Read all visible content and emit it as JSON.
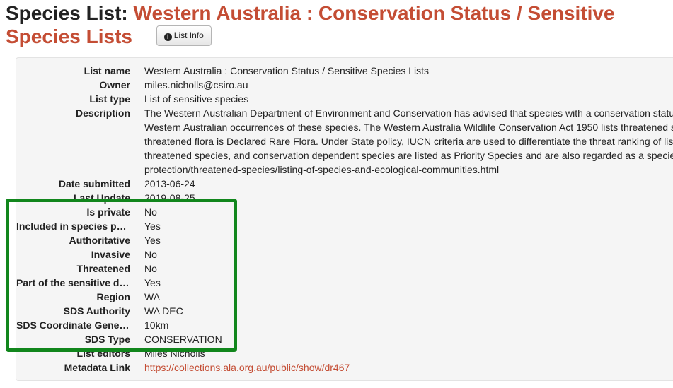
{
  "header": {
    "prefix": "Species List:",
    "list_name_line1": "Western Australia : Conservation Status / Sensitive",
    "list_name_line2": "Species Lists",
    "info_button": "List Info",
    "info_icon": "info-circle-icon"
  },
  "details": [
    {
      "label": "List name",
      "value": "Western Australia : Conservation Status / Sensitive Species Lists"
    },
    {
      "label": "Owner",
      "value": "miles.nicholls@csiro.au"
    },
    {
      "label": "List type",
      "value": "List of sensitive species"
    },
    {
      "label": "Description",
      "lines": [
        "The Western Australian Department of Environment and Conservation has advised that species with a conservation status",
        "Western Australian occurrences of these species. The Western Australia Wildlife Conservation Act 1950 lists threatened s",
        "threatened flora is Declared Rare Flora. Under State policy, IUCN criteria are used to differentiate the threat ranking of liste",
        "threatened species, and conservation dependent species are listed as Priority Species and are also regarded as a species",
        "protection/threatened-species/listing-of-species-and-ecological-communities.html"
      ]
    },
    {
      "label": "Date submitted",
      "value": "2013-06-24"
    },
    {
      "label": "Last Update",
      "value": "2019-08-25"
    },
    {
      "label": "Is private",
      "value": "No"
    },
    {
      "label": "Included in species pag…",
      "value": "Yes"
    },
    {
      "label": "Authoritative",
      "value": "Yes"
    },
    {
      "label": "Invasive",
      "value": "No"
    },
    {
      "label": "Threatened",
      "value": "No"
    },
    {
      "label": "Part of the sensitive da…",
      "value": "Yes"
    },
    {
      "label": "Region",
      "value": "WA"
    },
    {
      "label": "SDS Authority",
      "value": "WA DEC"
    },
    {
      "label": "SDS Coordinate Genera…",
      "value": "10km"
    },
    {
      "label": "SDS Type",
      "value": "CONSERVATION"
    },
    {
      "label": "List editors",
      "value": "Miles Nicholls"
    },
    {
      "label": "Metadata Link",
      "value": "https://collections.ala.org.au/public/show/dr467"
    }
  ],
  "colors": {
    "accent": "#c44d34",
    "highlight": "#11861c",
    "panel": "#f5f5f5"
  }
}
